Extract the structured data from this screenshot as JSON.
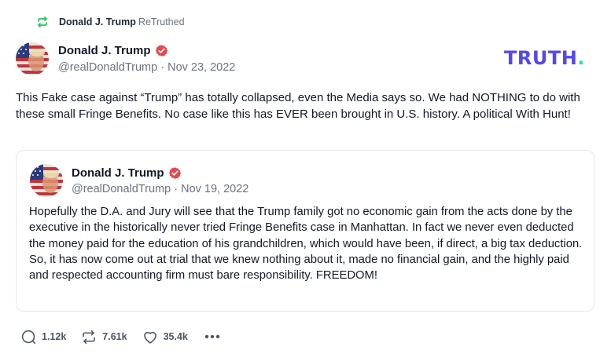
{
  "retruth": {
    "name": "Donald J. Trump",
    "label": "ReTruthed",
    "icon": "retruth-icon"
  },
  "post": {
    "author": {
      "display_name": "Donald J. Trump",
      "handle": "@realDonaldTrump",
      "verified_icon": "verified-badge-icon"
    },
    "separator": "·",
    "date": "Nov 23, 2022",
    "body": "This Fake case against “Trump” has totally collapsed, even the Media says so. We had NOTHING to do with these small Fringe Benefits. No case like this has EVER been brought in U.S. history. A political With Hunt!",
    "quote": {
      "author": {
        "display_name": "Donald J. Trump",
        "handle": "@realDonaldTrump"
      },
      "separator": "·",
      "date": "Nov 19, 2022",
      "body": "Hopefully the D.A. and Jury will see that the Trump family got no economic gain from the acts done by the executive in the historically never tried Fringe Benefits case in Manhattan. In fact we never even deducted the money paid for the education of his grandchildren, which would have been, if direct, a big tax deduction. So, it has now come out at trial that we knew nothing about it, made no financial gain, and the highly paid and respected accounting firm must bare responsibility. FREEDOM!"
    }
  },
  "brand": {
    "main": "TRUTH",
    "dot": "."
  },
  "actions": {
    "replies": "1.12k",
    "retruths": "7.61k",
    "likes": "35.4k"
  },
  "colors": {
    "brand_purple": "#5448ee",
    "brand_teal": "#17e5c9",
    "retruth_green": "#22c55e",
    "verified_red": "#e5484d",
    "muted_text": "#6b7280"
  }
}
